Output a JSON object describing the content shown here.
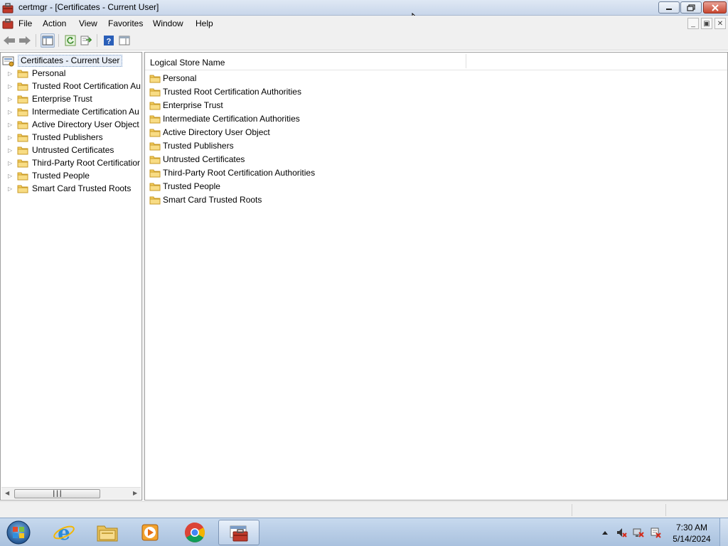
{
  "window": {
    "title": "certmgr - [Certificates - Current User]",
    "icon": "toolbox-icon",
    "controls": [
      "minimize-icon",
      "maximize-icon",
      "close-icon"
    ]
  },
  "menubar": {
    "items": [
      "File",
      "Action",
      "View",
      "Favorites",
      "Window",
      "Help"
    ]
  },
  "toolbar": {
    "buttons": [
      "back-arrow-icon",
      "forward-arrow-icon",
      "show-hide-console-tree-icon",
      "refresh-icon",
      "export-list-icon",
      "help-icon",
      "show-hide-action-pane-icon"
    ]
  },
  "tree": {
    "root": "Certificates - Current User",
    "items": [
      "Personal",
      "Trusted Root Certification Au",
      "Enterprise Trust",
      "Intermediate Certification Au",
      "Active Directory User Object",
      "Trusted Publishers",
      "Untrusted Certificates",
      "Third-Party Root Certificatior",
      "Trusted People",
      "Smart Card Trusted Roots"
    ]
  },
  "list": {
    "column_header": "Logical Store Name",
    "items": [
      "Personal",
      "Trusted Root Certification Authorities",
      "Enterprise Trust",
      "Intermediate Certification Authorities",
      "Active Directory User Object",
      "Trusted Publishers",
      "Untrusted Certificates",
      "Third-Party Root Certification Authorities",
      "Trusted People",
      "Smart Card Trusted Roots"
    ]
  },
  "taskbar": {
    "apps": [
      "internet-explorer-icon",
      "file-explorer-icon",
      "media-player-icon",
      "chrome-icon",
      "certmgr-toolbox-icon"
    ],
    "tray_icons": [
      "show-hidden-icons-arrow",
      "volume-muted-icon",
      "network-error-icon",
      "action-center-icon"
    ],
    "clock_time": "7:30 AM",
    "clock_date": "5/14/2024"
  },
  "colors": {
    "title_bar": "#c8d6ea",
    "taskbar": "#a9c1de",
    "folder": "#f2cc5b",
    "selection": "#e8eef7"
  }
}
